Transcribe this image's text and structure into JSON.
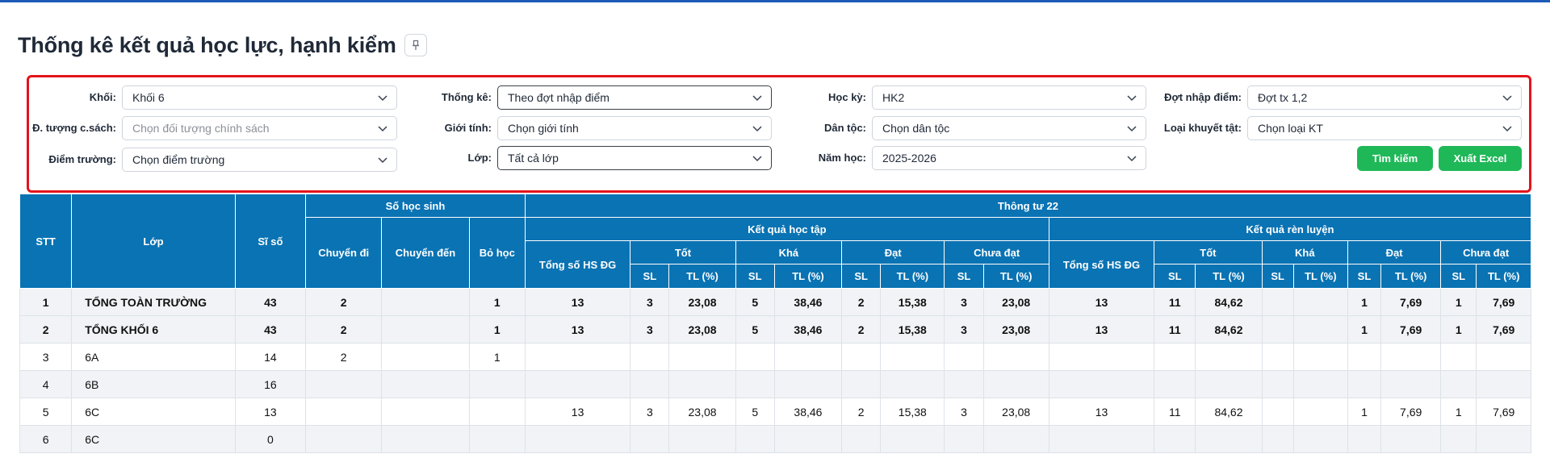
{
  "page": {
    "title": "Thống kê kết quả học lực, hạnh kiểm",
    "pin_icon": "pin-icon"
  },
  "filters": {
    "khoi": {
      "label": "Khối:",
      "value": "Khối 6",
      "placeholder": false
    },
    "doi_tuong": {
      "label": "Đ. tượng c.sách:",
      "value": "Chọn đối tượng chính sách",
      "placeholder": true
    },
    "diem_truong": {
      "label": "Điểm trường:",
      "value": "Chọn điểm trường",
      "placeholder": false
    },
    "thong_ke": {
      "label": "Thống kê:",
      "value": "Theo đợt nhập điểm",
      "placeholder": false
    },
    "gioi_tinh": {
      "label": "Giới tính:",
      "value": "Chọn giới tính",
      "placeholder": false
    },
    "lop": {
      "label": "Lớp:",
      "value": "Tất cả lớp",
      "placeholder": false
    },
    "hoc_ky": {
      "label": "Học kỳ:",
      "value": "HK2",
      "placeholder": false
    },
    "dan_toc": {
      "label": "Dân tộc:",
      "value": "Chọn dân tộc",
      "placeholder": false
    },
    "nam_hoc": {
      "label": "Năm học:",
      "value": "2025-2026",
      "placeholder": false
    },
    "dot_nhap": {
      "label": "Đợt nhập điểm:",
      "value": "Đợt tx 1,2",
      "placeholder": false
    },
    "khuyet_tat": {
      "label": "Loại khuyết tật:",
      "value": "Chọn loại KT",
      "placeholder": false
    }
  },
  "buttons": {
    "search": "Tìm kiếm",
    "export": "Xuất Excel"
  },
  "table": {
    "headers": {
      "stt": "STT",
      "lop": "Lớp",
      "si_so": "Sĩ số",
      "so_hoc_sinh": "Số học sinh",
      "chuyen_di": "Chuyển đi",
      "chuyen_den": "Chuyển đến",
      "bo_hoc": "Bỏ học",
      "thong_tu": "Thông tư 22",
      "kq_hoc_tap": "Kết quả học tập",
      "kq_ren_luyen": "Kết quả rèn luyện",
      "tong_so_1": "Tổng số HS ĐG",
      "tong_so_2": "Tổng số HS ĐG",
      "tot_1": "Tốt",
      "kha_1": "Khá",
      "dat_1": "Đạt",
      "chua_dat_1": "Chưa đạt",
      "tot_2": "Tốt",
      "kha_2": "Khá",
      "dat_2": "Đạt",
      "chua_dat_2": "Chưa đạt",
      "sl": "SL",
      "tl": "TL (%)"
    },
    "rows": [
      {
        "stt": "1",
        "lop": "TỔNG TOÀN TRƯỜNG",
        "si_so": "43",
        "chuyen_di": "2",
        "chuyen_den": "",
        "bo_hoc": "1",
        "ht_tong": "13",
        "ht_tot_sl": "3",
        "ht_tot_tl": "23,08",
        "ht_kha_sl": "5",
        "ht_kha_tl": "38,46",
        "ht_dat_sl": "2",
        "ht_dat_tl": "15,38",
        "ht_cd_sl": "3",
        "ht_cd_tl": "23,08",
        "rl_tong": "13",
        "rl_tot_sl": "11",
        "rl_tot_tl": "84,62",
        "rl_kha_sl": "",
        "rl_kha_tl": "",
        "rl_dat_sl": "1",
        "rl_dat_tl": "7,69",
        "rl_cd_sl": "1",
        "rl_cd_tl": "7,69",
        "bold": true
      },
      {
        "stt": "2",
        "lop": "TỔNG KHỐI 6",
        "si_so": "43",
        "chuyen_di": "2",
        "chuyen_den": "",
        "bo_hoc": "1",
        "ht_tong": "13",
        "ht_tot_sl": "3",
        "ht_tot_tl": "23,08",
        "ht_kha_sl": "5",
        "ht_kha_tl": "38,46",
        "ht_dat_sl": "2",
        "ht_dat_tl": "15,38",
        "ht_cd_sl": "3",
        "ht_cd_tl": "23,08",
        "rl_tong": "13",
        "rl_tot_sl": "11",
        "rl_tot_tl": "84,62",
        "rl_kha_sl": "",
        "rl_kha_tl": "",
        "rl_dat_sl": "1",
        "rl_dat_tl": "7,69",
        "rl_cd_sl": "1",
        "rl_cd_tl": "7,69",
        "bold": true
      },
      {
        "stt": "3",
        "lop": "6A",
        "si_so": "14",
        "chuyen_di": "2",
        "chuyen_den": "",
        "bo_hoc": "1",
        "ht_tong": "",
        "ht_tot_sl": "",
        "ht_tot_tl": "",
        "ht_kha_sl": "",
        "ht_kha_tl": "",
        "ht_dat_sl": "",
        "ht_dat_tl": "",
        "ht_cd_sl": "",
        "ht_cd_tl": "",
        "rl_tong": "",
        "rl_tot_sl": "",
        "rl_tot_tl": "",
        "rl_kha_sl": "",
        "rl_kha_tl": "",
        "rl_dat_sl": "",
        "rl_dat_tl": "",
        "rl_cd_sl": "",
        "rl_cd_tl": "",
        "bold": false
      },
      {
        "stt": "4",
        "lop": "6B",
        "si_so": "16",
        "chuyen_di": "",
        "chuyen_den": "",
        "bo_hoc": "",
        "ht_tong": "",
        "ht_tot_sl": "",
        "ht_tot_tl": "",
        "ht_kha_sl": "",
        "ht_kha_tl": "",
        "ht_dat_sl": "",
        "ht_dat_tl": "",
        "ht_cd_sl": "",
        "ht_cd_tl": "",
        "rl_tong": "",
        "rl_tot_sl": "",
        "rl_tot_tl": "",
        "rl_kha_sl": "",
        "rl_kha_tl": "",
        "rl_dat_sl": "",
        "rl_dat_tl": "",
        "rl_cd_sl": "",
        "rl_cd_tl": "",
        "bold": false
      },
      {
        "stt": "5",
        "lop": "6C",
        "si_so": "13",
        "chuyen_di": "",
        "chuyen_den": "",
        "bo_hoc": "",
        "ht_tong": "13",
        "ht_tot_sl": "3",
        "ht_tot_tl": "23,08",
        "ht_kha_sl": "5",
        "ht_kha_tl": "38,46",
        "ht_dat_sl": "2",
        "ht_dat_tl": "15,38",
        "ht_cd_sl": "3",
        "ht_cd_tl": "23,08",
        "rl_tong": "13",
        "rl_tot_sl": "11",
        "rl_tot_tl": "84,62",
        "rl_kha_sl": "",
        "rl_kha_tl": "",
        "rl_dat_sl": "1",
        "rl_dat_tl": "7,69",
        "rl_cd_sl": "1",
        "rl_cd_tl": "7,69",
        "bold": false
      },
      {
        "stt": "6",
        "lop": "6C",
        "si_so": "0",
        "chuyen_di": "",
        "chuyen_den": "",
        "bo_hoc": "",
        "ht_tong": "",
        "ht_tot_sl": "",
        "ht_tot_tl": "",
        "ht_kha_sl": "",
        "ht_kha_tl": "",
        "ht_dat_sl": "",
        "ht_dat_tl": "",
        "ht_cd_sl": "",
        "ht_cd_tl": "",
        "rl_tong": "",
        "rl_tot_sl": "",
        "rl_tot_tl": "",
        "rl_kha_sl": "",
        "rl_kha_tl": "",
        "rl_dat_sl": "",
        "rl_dat_tl": "",
        "rl_cd_sl": "",
        "rl_cd_tl": "",
        "bold": false,
        "partial": true
      }
    ]
  },
  "colors": {
    "header_bg": "#0a73b3",
    "button_green": "#1fb858",
    "highlight_border": "#e3141b",
    "top_bar": "#1e5bb8"
  }
}
